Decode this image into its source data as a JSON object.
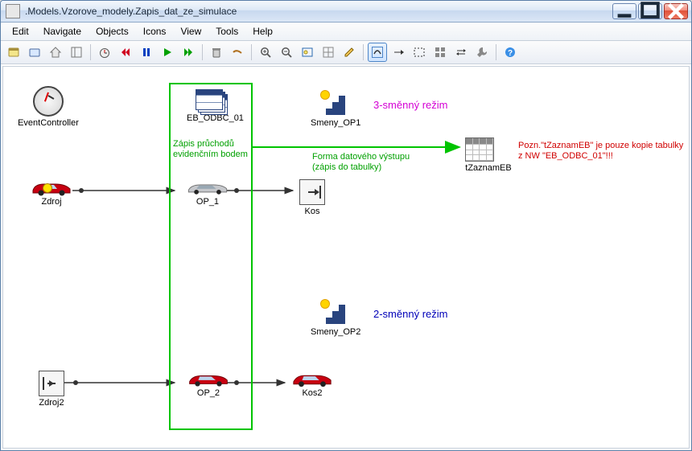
{
  "window": {
    "title": ".Models.Vzorove_modely.Zapis_dat_ze_simulace"
  },
  "menu": {
    "edit": "Edit",
    "navigate": "Navigate",
    "objects": "Objects",
    "icons": "Icons",
    "view": "View",
    "tools": "Tools",
    "help": "Help"
  },
  "toolbar_icons": [
    "open-class-library",
    "open-model",
    "home",
    "toggle-explorer",
    "sep",
    "event-controller",
    "rewind",
    "pause",
    "play",
    "fast-forward",
    "sep",
    "delete",
    "cut",
    "sep",
    "zoom-in",
    "zoom-out",
    "fit-window",
    "toggle-grid",
    "edit-pencil",
    "sep",
    "connector",
    "inheritance",
    "dotted-rect",
    "grid-4",
    "double-arrow",
    "wrench",
    "sep",
    "help"
  ],
  "nodes": {
    "event_controller": {
      "label": "EventController"
    },
    "eb_odbc": {
      "label": "EB_ODBC_01"
    },
    "smeny_op1": {
      "label": "Smeny_OP1"
    },
    "smeny_op2": {
      "label": "Smeny_OP2"
    },
    "tzaznameb": {
      "label": "tZaznamEB"
    },
    "zdroj": {
      "label": "Zdroj"
    },
    "op1": {
      "label": "OP_1"
    },
    "kos": {
      "label": "Kos"
    },
    "zdroj2": {
      "label": "Zdroj2"
    },
    "op2": {
      "label": "OP_2"
    },
    "kos2": {
      "label": "Kos2"
    }
  },
  "annot": {
    "regime3": "3-směnný režim",
    "regime2": "2-směnný režim",
    "zapis_line1": "Zápis průchodů",
    "zapis_line2": "evidenčním bodem",
    "forma_line1": "Forma datového výstupu",
    "forma_line2": "(zápis do tabulky)",
    "pozn_line1": "Pozn.\"tZaznamEB\" je pouze kopie tabulky",
    "pozn_line2": "z NW \"EB_ODBC_01\"!!!"
  },
  "colors": {
    "green": "#00c400",
    "magenta": "#d400d4",
    "blue": "#0000b8",
    "red": "#d00000"
  }
}
